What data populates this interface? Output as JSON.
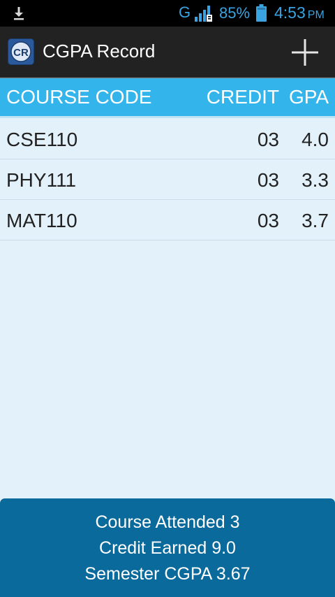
{
  "status_bar": {
    "network_type": "G",
    "battery": "85%",
    "time": "4:53",
    "ampm": "PM",
    "icons": [
      "download-icon",
      "signal-icon",
      "battery-icon"
    ],
    "accent_color": "#3aa3e0"
  },
  "app_bar": {
    "title": "CGPA Record",
    "logo_text": "CR",
    "add_icon": "plus-icon"
  },
  "table": {
    "headers": {
      "course_code": "COURSE CODE",
      "credit": "CREDIT",
      "gpa": "GPA"
    },
    "rows": [
      {
        "code": "CSE110",
        "credit": "03",
        "gpa": "4.0"
      },
      {
        "code": "PHY111",
        "credit": "03",
        "gpa": "3.3"
      },
      {
        "code": "MAT110",
        "credit": "03",
        "gpa": "3.7"
      }
    ],
    "header_color": "#33b4ea",
    "background_color": "#e3f1fa"
  },
  "summary": {
    "course_attended": "Course Attended 3",
    "credit_earned": "Credit Earned 9.0",
    "semester_cgpa": "Semester CGPA 3.67",
    "background_color": "#0a6a9c"
  }
}
